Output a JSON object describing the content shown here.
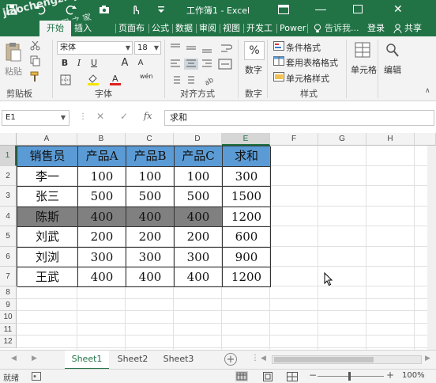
{
  "title_bar": {
    "title": "工作簿1 - Excel",
    "watermark": "jiaochengzhijia.com",
    "watermark_cn": "教程之家"
  },
  "tabs": [
    {
      "label": "开始",
      "active": true
    },
    {
      "label": "插入"
    },
    {
      "label": "页面布"
    },
    {
      "label": "公式"
    },
    {
      "label": "数据"
    },
    {
      "label": "审阅"
    },
    {
      "label": "视图"
    },
    {
      "label": "开发工"
    },
    {
      "label": "Power"
    }
  ],
  "tell_me": "告诉我...",
  "login": "登录",
  "share": "共享",
  "ribbon": {
    "clipboard": {
      "paste": "粘贴",
      "label": "剪贴板"
    },
    "font": {
      "name": "宋体",
      "size": "18",
      "bold": "B",
      "italic": "I",
      "underline": "U",
      "grow": "A",
      "shrink": "A",
      "phonetic": "wén",
      "label": "字体"
    },
    "alignment": {
      "label": "对齐方式"
    },
    "number": {
      "symbol": "%",
      "label": "数字"
    },
    "styles": {
      "conditional": "条件格式",
      "table": "套用表格格式",
      "cell": "单元格样式",
      "label": "样式"
    },
    "cells": {
      "label": "单元格"
    },
    "editing": {
      "label": "编辑"
    }
  },
  "formula_bar": {
    "name_box": "E1",
    "fx": "fx",
    "value": "求和"
  },
  "columns": [
    "A",
    "B",
    "C",
    "D",
    "E",
    "F",
    "G",
    "H"
  ],
  "rows": [
    "1",
    "2",
    "3",
    "4",
    "5",
    "6",
    "7",
    "8",
    "9",
    "10",
    "11",
    "12"
  ],
  "table": {
    "headers": [
      "销售员",
      "产品A",
      "产品B",
      "产品C",
      "求和"
    ],
    "rows": [
      [
        "李一",
        "100",
        "100",
        "100",
        "300"
      ],
      [
        "张三",
        "500",
        "500",
        "500",
        "1500"
      ],
      [
        "陈斯",
        "400",
        "400",
        "400",
        "1200"
      ],
      [
        "刘武",
        "200",
        "200",
        "200",
        "600"
      ],
      [
        "刘浏",
        "300",
        "300",
        "300",
        "900"
      ],
      [
        "王武",
        "400",
        "400",
        "400",
        "1200"
      ]
    ]
  },
  "sheets": [
    {
      "label": "Sheet1",
      "active": true
    },
    {
      "label": "Sheet2"
    },
    {
      "label": "Sheet3"
    }
  ],
  "status": {
    "ready": "就绪",
    "zoom": "100%"
  },
  "colors": {
    "excel_green": "#217346",
    "header_fill": "#5b9bd5",
    "highlight_fill": "#808080"
  }
}
